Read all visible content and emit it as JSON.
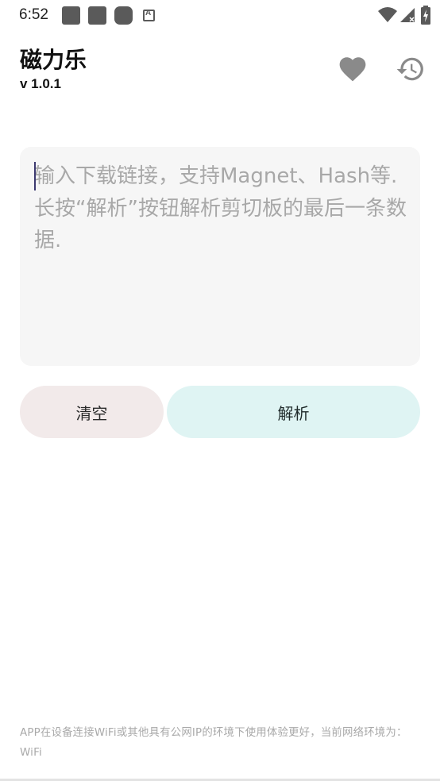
{
  "status_bar": {
    "time": "6:52",
    "notification_icons": [
      "app-icon",
      "app-icon",
      "app-icon",
      "keyboard-a-icon"
    ],
    "system_icons": [
      "wifi-icon",
      "cell-signal-icon",
      "battery-charging-icon"
    ]
  },
  "header": {
    "title": "磁力乐",
    "version": "v 1.0.1",
    "favorite_icon": "heart-icon",
    "history_icon": "history-icon"
  },
  "input": {
    "placeholder": "输入下载链接，支持Magnet、Hash等.\n长按“解析”按钮解析剪切板的最后一条数据.",
    "value": ""
  },
  "buttons": {
    "clear_label": "清空",
    "parse_label": "解析"
  },
  "footer": {
    "note": "APP在设备连接WiFi或其他具有公网IP的环境下使用体验更好，当前网络环境为：WiFi"
  },
  "colors": {
    "input_bg": "#f6f6f6",
    "clear_button_bg": "#f2eaea",
    "parse_button_bg": "#dff4f3",
    "icon_gray": "#8a8a8a",
    "placeholder_text": "#a8a8a8"
  }
}
